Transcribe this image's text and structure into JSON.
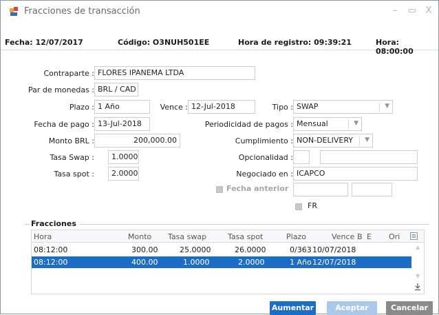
{
  "window": {
    "title": "Fracciones de transacción",
    "controls": [
      "minimize-icon",
      "maximize-icon",
      "close-icon"
    ],
    "close_glyph": "X",
    "minimize_glyph": "–",
    "maximize_glyph": "▭"
  },
  "info": {
    "fecha": "Fecha: 12/07/2017",
    "codigo": "Código: O3NUH501EE",
    "hora_registro": "Hora de registro: 09:39:21",
    "hora": "Hora: 08:00:00"
  },
  "form": {
    "contraparte_label": "Contraparte :",
    "contraparte_value": "FLORES IPANEMA LTDA",
    "par_label": "Par de monedas :",
    "par_value": "BRL / CAD",
    "plazo_label": "Plazo :",
    "plazo_value": "1 Año",
    "vence_label": "Vence :",
    "vence_value": "12-Jul-2018",
    "tipo_label": "Tipo :",
    "tipo_value": "SWAP",
    "fecha_pago_label": "Fecha de pago :",
    "fecha_pago_value": "13-Jul-2018",
    "periodicidad_label": "Periodicidad de pagos :",
    "periodicidad_value": "Mensual",
    "monto_label": "Monto BRL :",
    "monto_value": "200,000.00",
    "cumplimiento_label": "Cumplimiento :",
    "cumplimiento_value": "NON-DELIVERY",
    "tasa_swap_label": "Tasa Swap :",
    "tasa_swap_value": "1.0000",
    "opcionalidad_label": "Opcionalidad :",
    "opcionalidad_value": "",
    "tasa_spot_label": "Tasa spot :",
    "tasa_spot_value": "2.0000",
    "negociado_label": "Negociado en :",
    "negociado_value": "ICAPCO",
    "fecha_anterior_label": "Fecha anterior",
    "fr_label": "FR"
  },
  "fracciones": {
    "title": "Fracciones",
    "columns": [
      "Hora",
      "Monto",
      "Tasa swap",
      "Tasa spot",
      "Plazo",
      "Vence",
      "B",
      "E",
      "Ori"
    ],
    "rows": [
      {
        "hora": "08:12:00",
        "monto": "300.00",
        "tasa_swap": "25.0000",
        "tasa_spot": "26.0000",
        "plazo": "0/363",
        "vence": "10/07/2018",
        "selected": false
      },
      {
        "hora": "08:12:00",
        "monto": "400.00",
        "tasa_swap": "1.0000",
        "tasa_spot": "2.0000",
        "plazo": "1 Año",
        "vence": "12/07/2018",
        "selected": true
      }
    ]
  },
  "buttons": {
    "aumentar": "Aumentar",
    "aceptar": "Aceptar",
    "cancelar": "Cancelar"
  },
  "colors": {
    "primary": "#1c6ec4",
    "disabled": "#a9c8ea",
    "cancel": "#8a8a8a",
    "selected_row": "#1c6ec4"
  }
}
